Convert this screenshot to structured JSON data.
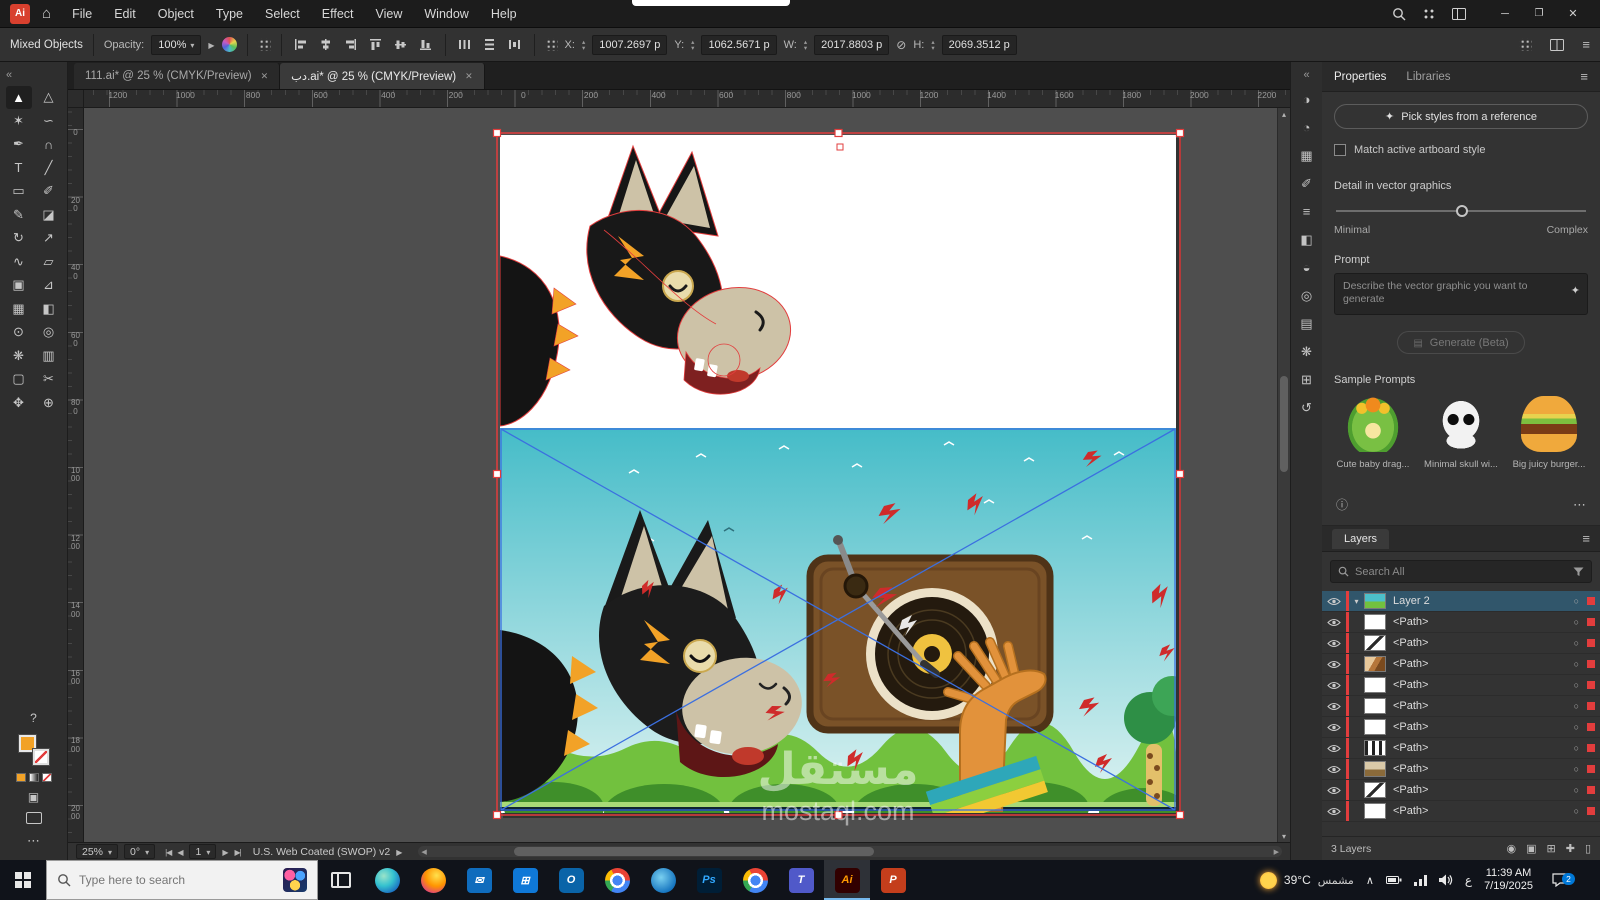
{
  "window": {
    "logo": "Ai"
  },
  "menubar": {
    "items": [
      "File",
      "Edit",
      "Object",
      "Type",
      "Select",
      "Effect",
      "View",
      "Window",
      "Help"
    ]
  },
  "controlbar": {
    "selection_label": "Mixed Objects",
    "opacity_label": "Opacity:",
    "opacity_value": "100%",
    "x_label": "X:",
    "x_value": "1007.2697 p",
    "y_label": "Y:",
    "y_value": "1062.5671 p",
    "w_label": "W:",
    "w_value": "2017.8803 p",
    "h_label": "H:",
    "h_value": "2069.3512 p"
  },
  "tabs": [
    {
      "name": "document-tab-111",
      "label": "111.ai* @ 25 % (CMYK/Preview)",
      "state": "inactive"
    },
    {
      "name": "document-tab-db",
      "label": "دب.ai* @ 25 % (CMYK/Preview)",
      "state": "active"
    }
  ],
  "rulers": {
    "h": [
      "1200",
      "1000",
      "800",
      "600",
      "400",
      "200",
      "0",
      "200",
      "400",
      "600",
      "800",
      "1000",
      "1200",
      "1400",
      "1600",
      "1800",
      "2000",
      "2200"
    ],
    "v": [
      "0",
      "200",
      "400",
      "600",
      "800",
      "1000",
      "1200",
      "1400",
      "1600",
      "1800",
      "2000"
    ]
  },
  "tools": [
    {
      "name": "selection-tool",
      "glyph": "▲",
      "state": "active"
    },
    {
      "name": "direct-selection-tool",
      "glyph": "△"
    },
    {
      "name": "magic-wand-tool",
      "glyph": "✶"
    },
    {
      "name": "lasso-tool",
      "glyph": "∽"
    },
    {
      "name": "pen-tool",
      "glyph": "✒"
    },
    {
      "name": "curvature-tool",
      "glyph": "∩"
    },
    {
      "name": "type-tool",
      "glyph": "T"
    },
    {
      "name": "line-segment-tool",
      "glyph": "╱"
    },
    {
      "name": "rectangle-tool",
      "glyph": "▭"
    },
    {
      "name": "paintbrush-tool",
      "glyph": "✐"
    },
    {
      "name": "pencil-tool",
      "glyph": "✎"
    },
    {
      "name": "eraser-tool",
      "glyph": "◪"
    },
    {
      "name": "rotate-tool",
      "glyph": "↻"
    },
    {
      "name": "scale-tool",
      "glyph": "↗"
    },
    {
      "name": "width-tool",
      "glyph": "∿"
    },
    {
      "name": "free-transform-tool",
      "glyph": "▱"
    },
    {
      "name": "shape-builder-tool",
      "glyph": "▣"
    },
    {
      "name": "perspective-grid-tool",
      "glyph": "⊿"
    },
    {
      "name": "mesh-tool",
      "glyph": "▦"
    },
    {
      "name": "gradient-tool",
      "glyph": "◧"
    },
    {
      "name": "eyedropper-tool",
      "glyph": "⊙"
    },
    {
      "name": "blend-tool",
      "glyph": "◎"
    },
    {
      "name": "symbol-sprayer-tool",
      "glyph": "❋"
    },
    {
      "name": "column-graph-tool",
      "glyph": "▥"
    },
    {
      "name": "artboard-tool",
      "glyph": "▢"
    },
    {
      "name": "slice-tool",
      "glyph": "✂"
    },
    {
      "name": "hand-tool",
      "glyph": "✥"
    },
    {
      "name": "zoom-tool",
      "glyph": "⊕"
    }
  ],
  "right_strip": [
    {
      "name": "panel-color",
      "glyph": "◑"
    },
    {
      "name": "panel-color-guide",
      "glyph": "◔"
    },
    {
      "name": "panel-swatches",
      "glyph": "▦"
    },
    {
      "name": "panel-brushes",
      "glyph": "✐"
    },
    {
      "name": "panel-stroke",
      "glyph": "≡"
    },
    {
      "name": "panel-gradient",
      "glyph": "◧"
    },
    {
      "name": "panel-transparency",
      "glyph": "◒"
    },
    {
      "name": "panel-appearance",
      "glyph": "◎"
    },
    {
      "name": "panel-graphic-styles",
      "glyph": "▤"
    },
    {
      "name": "panel-symbols",
      "glyph": "❋"
    },
    {
      "name": "panel-artboards",
      "glyph": "⊞"
    },
    {
      "name": "panel-history",
      "glyph": "↺"
    }
  ],
  "properties": {
    "tab_properties": "Properties",
    "tab_libraries": "Libraries",
    "pick_button": "Pick styles from a reference",
    "match_label": "Match active artboard style",
    "detail_label": "Detail in vector graphics",
    "minimal_label": "Minimal",
    "complex_label": "Complex",
    "prompt_label": "Prompt",
    "prompt_placeholder": "Describe the vector graphic you want to generate",
    "generate_label": "Generate (Beta)",
    "samples_label": "Sample Prompts",
    "samples": [
      {
        "name": "sample-prompt-dragon",
        "label": "Cute baby drag...",
        "kind": "dragon"
      },
      {
        "name": "sample-prompt-skull",
        "label": "Minimal skull wi...",
        "kind": "skull"
      },
      {
        "name": "sample-prompt-burger",
        "label": "Big juicy burger...",
        "kind": "burger"
      }
    ]
  },
  "layers": {
    "title": "Layers",
    "search_placeholder": "Search All",
    "rows": [
      {
        "name": "layer-row-layer-2",
        "label": "Layer 2",
        "thumb": "scene",
        "state": "selected",
        "twirl": "▾"
      },
      {
        "name": "layer-row-path-1",
        "label": "<Path>",
        "thumb": "white",
        "twirl": ""
      },
      {
        "name": "layer-row-path-2",
        "label": "<Path>",
        "thumb": "diag",
        "twirl": ""
      },
      {
        "name": "layer-row-path-3",
        "label": "<Path>",
        "thumb": "art1",
        "twirl": ""
      },
      {
        "name": "layer-row-path-4",
        "label": "<Path>",
        "thumb": "white",
        "twirl": ""
      },
      {
        "name": "layer-row-path-5",
        "label": "<Path>",
        "thumb": "white",
        "twirl": ""
      },
      {
        "name": "layer-row-path-6",
        "label": "<Path>",
        "thumb": "white",
        "twirl": ""
      },
      {
        "name": "layer-row-path-7",
        "label": "<Path>",
        "thumb": "bars",
        "twirl": ""
      },
      {
        "name": "layer-row-path-8",
        "label": "<Path>",
        "thumb": "art2",
        "twirl": ""
      },
      {
        "name": "layer-row-path-9",
        "label": "<Path>",
        "thumb": "diag",
        "twirl": ""
      },
      {
        "name": "layer-row-path-10",
        "label": "<Path>",
        "thumb": "white",
        "twirl": ""
      }
    ],
    "count": "3 Layers"
  },
  "statusbar": {
    "zoom": "25%",
    "rotation": "0°",
    "artboard": "1",
    "profile": "U.S. Web Coated (SWOP) v2"
  },
  "canvas": {
    "watermark_title": "مستقل",
    "watermark_domain": "mostaql.com"
  },
  "taskbar": {
    "search_placeholder": "Type here to search",
    "apps": [
      {
        "name": "taskbar-task-view",
        "kind": "taskview"
      },
      {
        "name": "taskbar-edge",
        "kind": "edge"
      },
      {
        "name": "taskbar-firefox",
        "kind": "firefox"
      },
      {
        "name": "taskbar-mail",
        "kind": "mail",
        "label": "✉"
      },
      {
        "name": "taskbar-store",
        "kind": "store",
        "label": "⊞"
      },
      {
        "name": "taskbar-outlook",
        "kind": "outlook",
        "label": "O"
      },
      {
        "name": "taskbar-chrome",
        "kind": "chrome"
      },
      {
        "name": "taskbar-edge-2",
        "kind": "browser"
      },
      {
        "name": "taskbar-photoshop",
        "kind": "photoshop",
        "label": "Ps"
      },
      {
        "name": "taskbar-chrome-2",
        "kind": "chrome"
      },
      {
        "name": "taskbar-teams",
        "kind": "teams",
        "label": "T"
      },
      {
        "name": "taskbar-illustrator",
        "kind": "illustrator",
        "label": "Ai",
        "state": "active"
      },
      {
        "name": "taskbar-powerpoint",
        "kind": "powerpoint",
        "label": "P"
      }
    ]
  },
  "tray": {
    "temp": "39°C",
    "weather_desc": "مشمس",
    "lang": "ع",
    "time": "11:39 AM",
    "date": "7/19/2025",
    "badge": "2"
  }
}
